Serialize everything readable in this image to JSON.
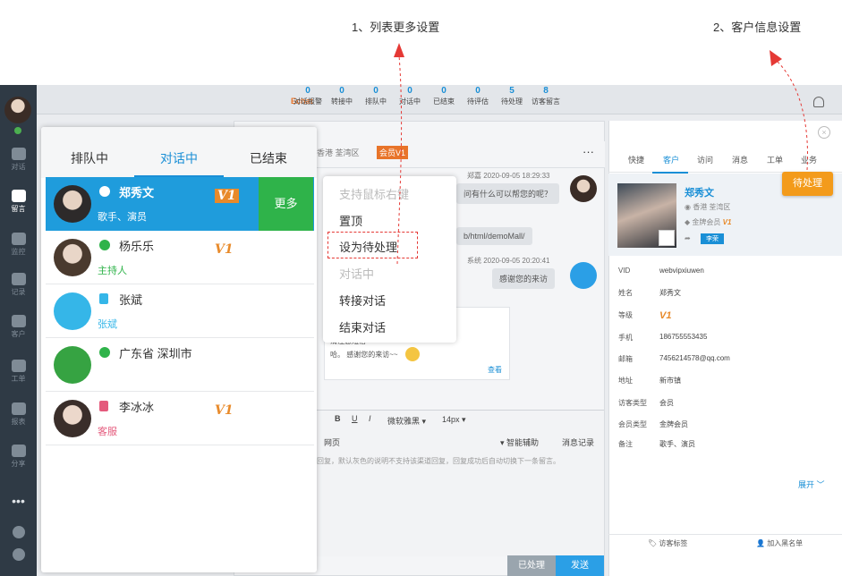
{
  "annotations": {
    "step1": "1、列表更多设置",
    "step2": "2、客户信息设置"
  },
  "sidebar": {
    "items": [
      {
        "label": "对话",
        "icon": "chat-icon"
      },
      {
        "label": "留言",
        "icon": "mail-icon"
      },
      {
        "label": "监控",
        "icon": "eye-icon"
      },
      {
        "label": "记录",
        "icon": "clock-icon"
      },
      {
        "label": "客户",
        "icon": "contact-card-icon"
      },
      {
        "label": "工单",
        "icon": "document-icon"
      },
      {
        "label": "报表",
        "icon": "pie-chart-icon"
      },
      {
        "label": "分享",
        "icon": "share-icon"
      }
    ],
    "more": "•••"
  },
  "topbar": {
    "logo": "Echat",
    "stats": [
      {
        "n": "0",
        "l": "对话报警"
      },
      {
        "n": "0",
        "l": "转接中"
      },
      {
        "n": "0",
        "l": "排队中"
      },
      {
        "n": "0",
        "l": "对话中"
      },
      {
        "n": "0",
        "l": "已结束"
      },
      {
        "n": "0",
        "l": "待评估"
      },
      {
        "n": "5",
        "l": "待处理"
      },
      {
        "n": "8",
        "l": "访客留言"
      }
    ]
  },
  "chat": {
    "location": "香港 荃湾区",
    "member_badge": "会员V1",
    "menu_dots": "···",
    "msg1_meta": "郑嘉 2020-09-05 18:29:33",
    "msg1": "问有什么可以帮您的呢？",
    "link": "b/html/demoMall/",
    "msg2_meta": "系统 2020-09-05 20:20:41",
    "msg2": "感谢您的来访",
    "card_text": "清注意短信\n哈。 感谢您的来访~~",
    "card_link": "查看",
    "toolbar": {
      "font": "微软雅黑 ▾",
      "size": "14px ▾",
      "web": "网页",
      "assist": "▾ 智能辅助",
      "history": "消息记录"
    },
    "hint": "回复，默认灰色的说明不支持该渠道回复，回复成功后自动切换下一条留言。",
    "done": "已处理",
    "send": "发送"
  },
  "right": {
    "tabs": [
      "快捷",
      "客户",
      "访问",
      "消息",
      "工单",
      "业务"
    ],
    "pending": "待处理",
    "name": "郑秀文",
    "loc": "香港 荃湾区",
    "level": "金牌会员",
    "vip": "V1",
    "tag": "李荣",
    "fields": [
      {
        "k": "VID",
        "v": "webvipxiuwen"
      },
      {
        "k": "姓名",
        "v": "郑秀文"
      },
      {
        "k": "等级",
        "v": "V1"
      },
      {
        "k": "手机",
        "v": "186755553435"
      },
      {
        "k": "邮箱",
        "v": "7456214578@qq.com"
      },
      {
        "k": "地址",
        "v": "新市镇"
      },
      {
        "k": "访客类型",
        "v": "会员"
      },
      {
        "k": "会员类型",
        "v": "金牌会员"
      },
      {
        "k": "备注",
        "v": "歌手、演员"
      }
    ],
    "expand": "展开 ﹀",
    "visitor_tag": "访客标签",
    "blacklist": "加入黑名单"
  },
  "list": {
    "tabs": [
      "排队中",
      "对话中",
      "已结束"
    ],
    "more": "更多",
    "rows": [
      {
        "name": "郑秀文",
        "sub": "歌手、演员",
        "vip": "V1",
        "channel": "globe-icon"
      },
      {
        "name": "杨乐乐",
        "sub": "主持人",
        "vip": "V1",
        "channel": "globe-icon"
      },
      {
        "name": "张斌",
        "sub": "张斌",
        "vip": "",
        "channel": "phone-icon"
      },
      {
        "name": "广东省 深圳市",
        "sub": "",
        "vip": "",
        "channel": "globe-icon"
      },
      {
        "name": "李冰冰",
        "sub": "客服",
        "vip": "V1",
        "channel": "monitor-icon"
      }
    ]
  },
  "menu": {
    "items": [
      {
        "label": "支持鼠标右键",
        "disabled": true
      },
      {
        "label": "置顶",
        "disabled": false
      },
      {
        "label": "设为待处理",
        "disabled": false
      },
      {
        "label": "对话中",
        "disabled": true
      },
      {
        "label": "转接对话",
        "disabled": false
      },
      {
        "label": "结束对话",
        "disabled": false
      }
    ]
  }
}
